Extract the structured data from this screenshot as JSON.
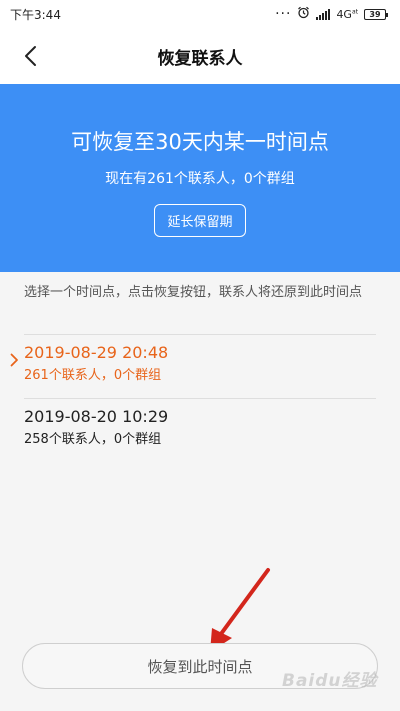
{
  "status_bar": {
    "time": "下午3:44",
    "dots": "···",
    "network": "4G",
    "network_sub": "at",
    "battery": "39",
    "icons": [
      "alarm-icon",
      "signal-icon",
      "battery-icon"
    ]
  },
  "header": {
    "back_icon": "chevron-left-icon",
    "title": "恢复联系人"
  },
  "banner": {
    "heading": "可恢复至30天内某一时间点",
    "subtitle": "现在有261个联系人，0个群组",
    "extend_label": "延长保留期",
    "color": "#3d8ff5"
  },
  "instruction": "选择一个时间点，点击恢复按钮，联系人将还原到此时间点",
  "snapshots": [
    {
      "time": "2019-08-29 20:48",
      "detail": "261个联系人，0个群组",
      "selected": true
    },
    {
      "time": "2019-08-20 10:29",
      "detail": "258个联系人，0个群组",
      "selected": false
    }
  ],
  "accent_color": "#e8641a",
  "restore_label": "恢复到此时间点",
  "watermark": "Baidu经验",
  "annotation_color": "#d3261c"
}
